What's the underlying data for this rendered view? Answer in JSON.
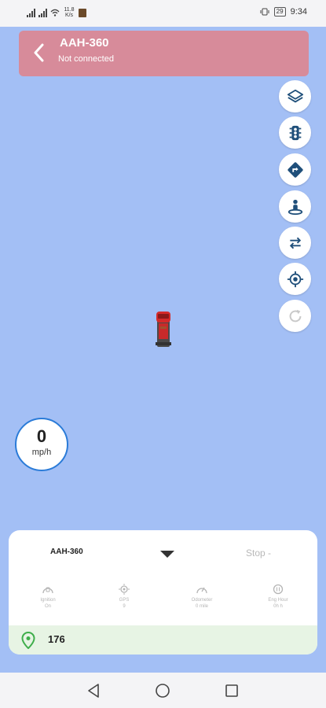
{
  "status_bar": {
    "network_speed": "11.8 K/s",
    "battery": "29",
    "time": "9:34"
  },
  "header": {
    "title": "AAH-360",
    "subtitle": "Not connected"
  },
  "map_controls": [
    {
      "name": "layers-button",
      "icon": "layers-icon"
    },
    {
      "name": "traffic-button",
      "icon": "traffic-light-icon"
    },
    {
      "name": "directions-button",
      "icon": "directions-icon"
    },
    {
      "name": "street-view-button",
      "icon": "street-view-icon"
    },
    {
      "name": "swap-button",
      "icon": "swap-arrows-icon"
    },
    {
      "name": "my-location-button",
      "icon": "crosshair-icon"
    },
    {
      "name": "refresh-button",
      "icon": "refresh-icon"
    }
  ],
  "speedometer": {
    "value": "0",
    "unit": "mp/h"
  },
  "panel": {
    "vehicle": "AAH-360",
    "status": "Stop -",
    "stats": [
      {
        "label": "Ignition",
        "value": "On",
        "icon": "ignition-icon"
      },
      {
        "label": "GPS",
        "value": "9",
        "icon": "gps-icon"
      },
      {
        "label": "Odometer",
        "value": "0 mile",
        "icon": "odometer-icon"
      },
      {
        "label": "Eng Hour",
        "value": "0h h",
        "icon": "engine-hour-icon"
      }
    ],
    "count": "176"
  },
  "colors": {
    "map_background": "#a3bff5",
    "header_background": "#d78b9a",
    "speedometer_ring": "#2a7bd8",
    "footer_background": "#e7f4e4",
    "pin": "#3fae4b"
  }
}
